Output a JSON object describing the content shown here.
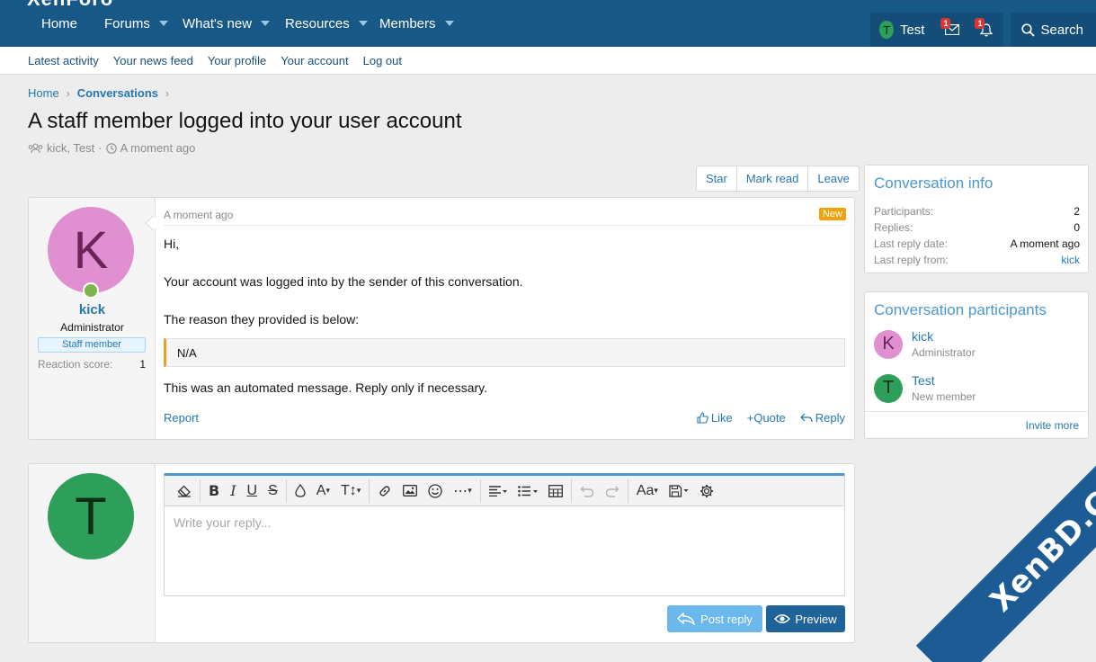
{
  "nav": {
    "logo": "XenForo",
    "tabs": [
      {
        "label": "Home"
      },
      {
        "label": "Forums"
      },
      {
        "label": "What's new"
      },
      {
        "label": "Resources"
      },
      {
        "label": "Members"
      }
    ],
    "user_initial": "T",
    "user_name": "Test",
    "inbox_count": "1",
    "alerts_count": "1",
    "search_label": "Search"
  },
  "subnav": {
    "items": [
      "Latest activity",
      "Your news feed",
      "Your profile",
      "Your account",
      "Log out"
    ]
  },
  "breadcrumb": {
    "home": "Home",
    "current": "Conversations"
  },
  "page": {
    "title": "A staff member logged into your user account",
    "participants": "kick, Test",
    "time": "A moment ago"
  },
  "actions": {
    "star": "Star",
    "mark_read": "Mark read",
    "leave": "Leave"
  },
  "message": {
    "author_initial": "K",
    "author": "kick",
    "author_title": "Administrator",
    "badge": "Staff member",
    "reaction_label": "Reaction score:",
    "reaction_value": "1",
    "date": "A moment ago",
    "new_label": "New",
    "line1": "Hi,",
    "line2": "Your account was logged into by the sender of this conversation.",
    "line3": "The reason they provided is below:",
    "quote": "N/A",
    "line4": "This was an automated message. Reply only if necessary.",
    "report": "Report",
    "like": "Like",
    "quote_btn": "+Quote",
    "reply": "Reply"
  },
  "reply_box": {
    "avatar_initial": "T",
    "placeholder": "Write your reply...",
    "post_reply": "Post reply",
    "preview": "Preview"
  },
  "sidebar": {
    "info_title": "Conversation info",
    "info_rows": [
      {
        "label": "Participants:",
        "value": "2"
      },
      {
        "label": "Replies:",
        "value": "0"
      },
      {
        "label": "Last reply date:",
        "value": "A moment ago"
      },
      {
        "label": "Last reply from:",
        "value": "kick"
      }
    ],
    "participants_title": "Conversation participants",
    "participants": [
      {
        "initial": "K",
        "name": "kick",
        "role": "Administrator"
      },
      {
        "initial": "T",
        "name": "Test",
        "role": "New member"
      }
    ],
    "invite_more": "Invite more"
  },
  "watermark": "XenBD.Com",
  "colors": {
    "nav_bg": "#185886",
    "accent": "#2577b1",
    "new_badge": "#f0a30a"
  }
}
